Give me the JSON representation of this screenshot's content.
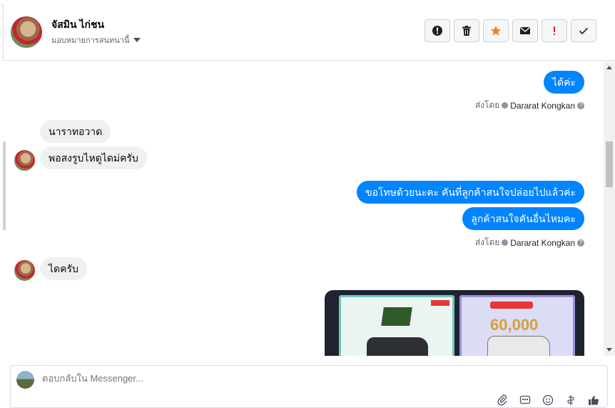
{
  "header": {
    "contact_name": "จัสมิน ไก่ชน",
    "assign_label": "มอบหมายการสนทนานี้",
    "actions": [
      {
        "name": "spam-button",
        "icon": "alert-circle-icon"
      },
      {
        "name": "delete-button",
        "icon": "trash-icon"
      },
      {
        "name": "star-button",
        "icon": "star-icon",
        "color": "#f5821f"
      },
      {
        "name": "mark-unread-button",
        "icon": "envelope-icon"
      },
      {
        "name": "follow-up-button",
        "icon": "exclamation-icon",
        "color": "#e02020"
      },
      {
        "name": "done-button",
        "icon": "check-icon"
      }
    ]
  },
  "messages": [
    {
      "dir": "out",
      "text": "ได้ค่ะ"
    },
    {
      "dir": "meta",
      "prefix": "ส่งโดย",
      "author": "Dararat Kongkan"
    },
    {
      "dir": "in",
      "text": "นาราทอวาด"
    },
    {
      "dir": "in",
      "text": "พอสงรูบไหดูไดม่ครับ"
    },
    {
      "dir": "out",
      "text": "ขอโทษด้วยนะคะ คันที่ลูกค้าสนใจปล่อยไปแล้วค่ะ"
    },
    {
      "dir": "out",
      "text": "ลูกค้าสนใจคันอื่นไหมคะ"
    },
    {
      "dir": "meta",
      "prefix": "ส่งโดย",
      "author": "Dararat Kongkan"
    },
    {
      "dir": "in",
      "text": "ไดครับ"
    }
  ],
  "image_card": {
    "right_panel_price": "60,000",
    "icon": "car-listing-image"
  },
  "reply": {
    "placeholder": "ตอบกลับใน Messenger...",
    "tools": [
      "attachment-icon",
      "saved-reply-icon",
      "emoji-icon",
      "tag-icon",
      "thumbs-up-icon"
    ]
  },
  "colors": {
    "outgoing_bubble": "#0084ff",
    "incoming_bubble": "#f0f0f0"
  }
}
